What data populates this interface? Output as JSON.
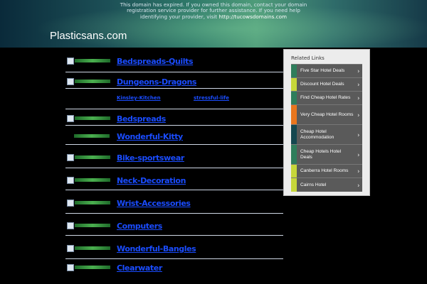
{
  "banner": {
    "expired_line1": "This domain has expired. If you owned this domain, contact your domain",
    "expired_line2": "registration service provider for further assistance. If you need help",
    "expired_line3_prefix": "identifying your provider, visit ",
    "expired_link": "http://tucowsdomains.com"
  },
  "domain": "Plasticsans.com",
  "main": {
    "rows": [
      {
        "label": "Bedspreads-Quilts"
      },
      {
        "label": "Dungeons-Dragons"
      },
      {
        "label": "",
        "sub_left": "Kinsley-Kitchen",
        "sub_right": "stressful-life"
      },
      {
        "label": "Bedspreads"
      },
      {
        "label": "Wonderful-Kitty"
      },
      {
        "label": "Bike-sportswear"
      },
      {
        "label": "Neck-Decoration"
      },
      {
        "label": "Wrist-Accessories"
      },
      {
        "label": "Computers"
      },
      {
        "label": "Wonderful-Bangles"
      },
      {
        "label": "Clearwater"
      }
    ]
  },
  "sidebar": {
    "title": "Related Links",
    "items": [
      {
        "label": "Five Star Hotel Deals",
        "color": "#2e7d5b"
      },
      {
        "label": "Discount Hotel Deals",
        "color": "#c6d63a"
      },
      {
        "label": "Find Cheap Hotel Rates",
        "color": "#2e7d5b"
      },
      {
        "label": "Very Cheap Hotel Rooms",
        "color": "#e8761e"
      },
      {
        "label": "Cheap Hotel Accommodation",
        "color": "#14474f"
      },
      {
        "label": "Cheap Hotels Hotel Deals",
        "color": "#2e7d5b"
      },
      {
        "label": "Canberra Hotel Rooms",
        "color": "#c6d63a"
      },
      {
        "label": "Cairns Hotel",
        "color": "#c6d63a"
      }
    ]
  }
}
